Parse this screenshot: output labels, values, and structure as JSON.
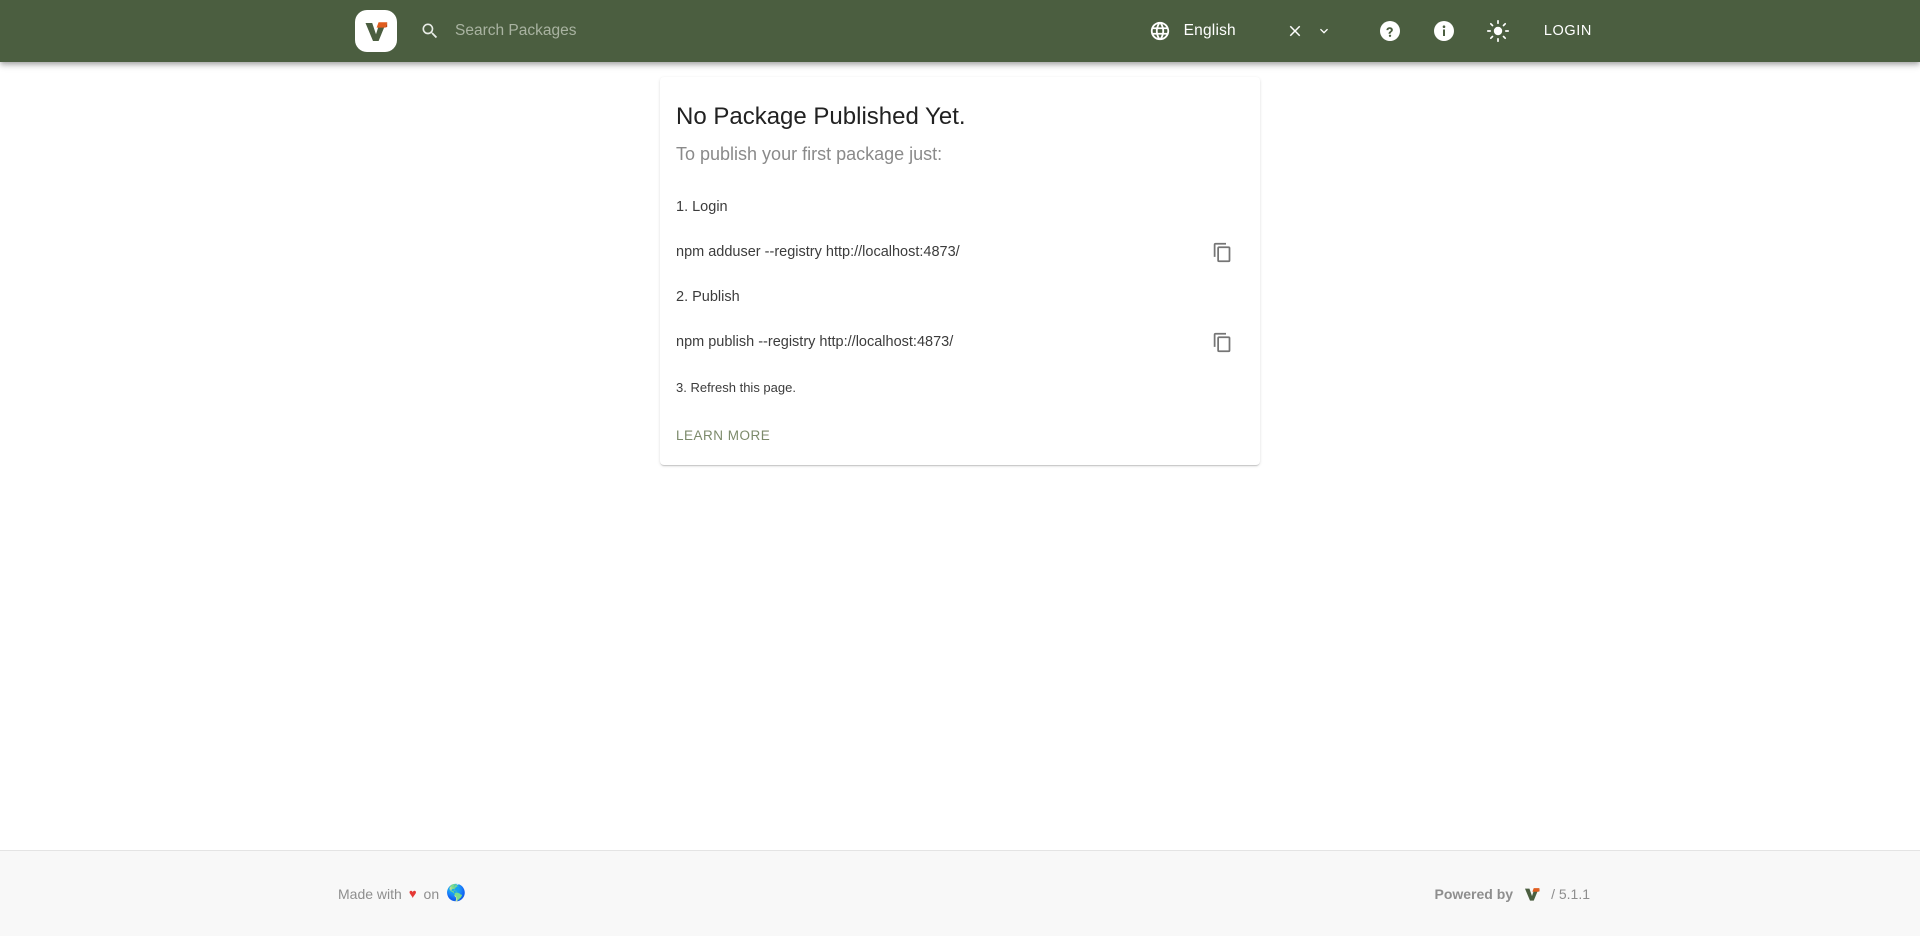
{
  "header": {
    "logo_icon": "verdaccio-logo-icon",
    "search": {
      "icon": "search-icon",
      "placeholder": "Search Packages",
      "value": ""
    },
    "language": {
      "globe_icon": "globe-icon",
      "label": "English",
      "clear_icon": "close-icon",
      "caret_icon": "chevron-down-icon"
    },
    "help_icon": "help-circle-icon",
    "info_icon": "info-circle-icon",
    "theme_icon": "brightness-sun-icon",
    "login_label": "LOGIN",
    "background_color": "#4b5e40"
  },
  "card": {
    "title": "No Package Published Yet.",
    "subtitle": "To publish your first package just:",
    "steps": [
      {
        "label": "1. Login",
        "copyable": false
      },
      {
        "label": "npm adduser --registry http://localhost:4873/",
        "copyable": true,
        "copy_icon": "copy-icon"
      },
      {
        "label": "2. Publish",
        "copyable": false
      },
      {
        "label": "npm publish --registry http://localhost:4873/",
        "copyable": true,
        "copy_icon": "copy-icon"
      },
      {
        "label": "3. Refresh this page.",
        "copyable": false,
        "small": true
      }
    ],
    "learn_more_label": "LEARN MORE"
  },
  "footer": {
    "made_with_prefix": "Made with",
    "heart": "♥",
    "made_with_suffix": "on",
    "earth_icon": "earth-globe-icon",
    "earth": "🌎",
    "powered_by_label": "Powered by",
    "logo_icon": "verdaccio-logo-icon",
    "version": "/ 5.1.1"
  }
}
